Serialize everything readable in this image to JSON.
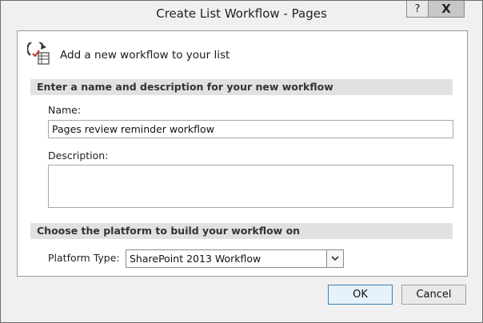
{
  "window": {
    "title": "Create List Workflow - Pages",
    "help_label": "?",
    "close_label": "X"
  },
  "header": {
    "text": "Add a new workflow to your list",
    "icon": "workflow-list-icon"
  },
  "sections": {
    "name_description": "Enter a name and description for your new workflow",
    "platform": "Choose the platform to build your workflow on"
  },
  "fields": {
    "name_label": "Name:",
    "name_value": "Pages review reminder workflow",
    "description_label": "Description:",
    "description_value": "",
    "platform_label": "Platform Type:",
    "platform_value": "SharePoint 2013 Workflow"
  },
  "buttons": {
    "ok": "OK",
    "cancel": "Cancel"
  },
  "colors": {
    "accent_check": "#c0392b",
    "primary_button_border": "#3c7fb1"
  }
}
